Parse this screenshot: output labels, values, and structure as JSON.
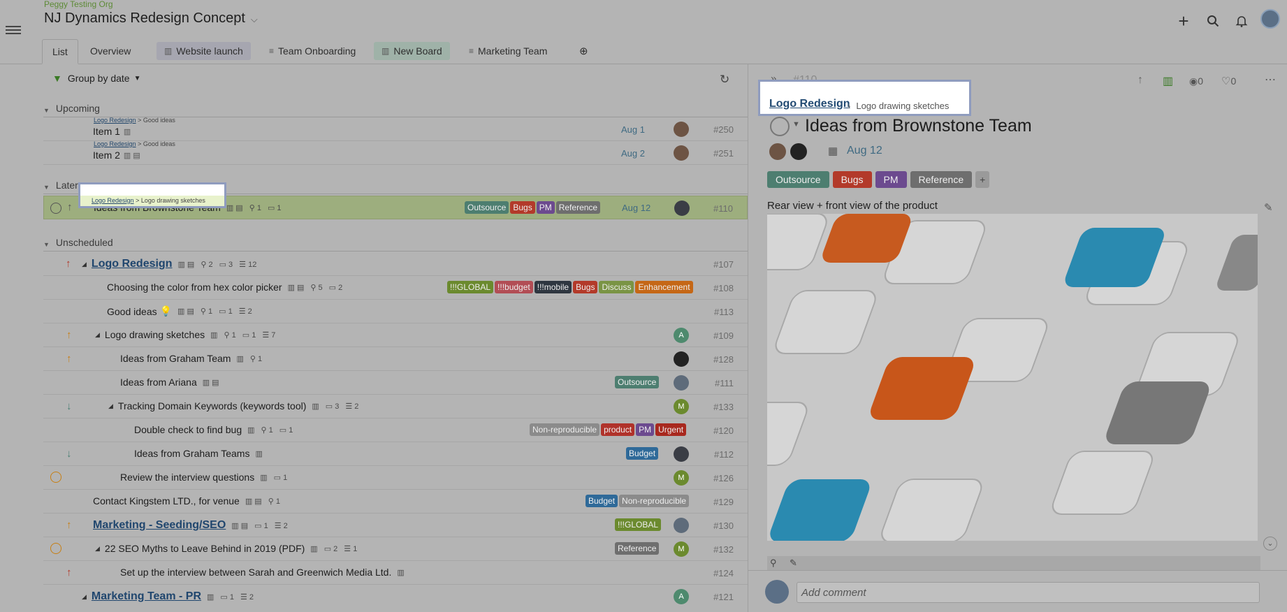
{
  "header": {
    "org": "Peggy Testing Org",
    "title": "NJ Dynamics Redesign Concept"
  },
  "tabs": [
    "List",
    "Overview",
    "Website launch",
    "Team Onboarding",
    "New Board",
    "Marketing Team"
  ],
  "toolbar": {
    "group_by": "Group by date"
  },
  "sections": {
    "upcoming": "Upcoming",
    "later": "Later",
    "unscheduled": "Unscheduled"
  },
  "crumb_parent": "Logo Redesign",
  "crumb_good": "Good ideas",
  "crumb_sketch": "Logo drawing sketches",
  "rows": [
    {
      "name": "Item 1",
      "date": "Aug 1",
      "num": "#250"
    },
    {
      "name": "Item 2",
      "date": "Aug 2",
      "num": "#251"
    },
    {
      "name": "Ideas from Brownstone Team",
      "date": "Aug 12",
      "num": "#110",
      "attach": "1",
      "comments": "1"
    },
    {
      "name": "Logo Redesign",
      "num": "#107",
      "attach": "2",
      "comments": "3",
      "subtasks": "12"
    },
    {
      "name": "Choosing the color from hex color picker",
      "num": "#108",
      "attach": "5",
      "comments": "2"
    },
    {
      "name": "Good ideas",
      "num": "#113",
      "attach": "1",
      "comments": "1",
      "subtasks": "2"
    },
    {
      "name": "Logo drawing sketches",
      "num": "#109",
      "attach": "1",
      "comments": "1",
      "subtasks": "7"
    },
    {
      "name": "Ideas from Graham Team",
      "num": "#128",
      "attach": "1"
    },
    {
      "name": "Ideas from Ariana",
      "num": "#111"
    },
    {
      "name": "Tracking Domain Keywords (keywords tool)",
      "num": "#133",
      "comments": "3",
      "subtasks": "2"
    },
    {
      "name": "Double check to find bug",
      "num": "#120",
      "attach": "1",
      "comments": "1"
    },
    {
      "name": "Ideas from Graham Teams",
      "num": "#112"
    },
    {
      "name": "Review the interview questions",
      "num": "#126",
      "comments": "1"
    },
    {
      "name": "Contact Kingstem LTD., for venue",
      "num": "#129",
      "attach": "1"
    },
    {
      "name": "Marketing - Seeding/SEO",
      "num": "#130",
      "comments": "1",
      "subtasks": "2"
    },
    {
      "name": "22 SEO Myths to Leave Behind in 2019 (PDF)",
      "num": "#132",
      "comments": "2",
      "subtasks": "1"
    },
    {
      "name": "Set up the interview between Sarah and Greenwich Media Ltd.",
      "num": "#124"
    },
    {
      "name": "Marketing Team - PR",
      "num": "#121",
      "comments": "1",
      "subtasks": "2"
    }
  ],
  "tags": {
    "outsource": "Outsource",
    "bugs": "Bugs",
    "pm": "PM",
    "reference": "Reference",
    "global": "!!!GLOBAL",
    "budget_x": "!!!budget",
    "mobile": "!!!mobile",
    "discuss": "Discuss",
    "enhancement": "Enhancement",
    "nonrepro": "Non-reproducible",
    "product": "product",
    "urgent": "Urgent",
    "budget": "Budget"
  },
  "detail": {
    "num": "#110",
    "watchers": "0",
    "likes": "0",
    "title": "Ideas from Brownstone Team",
    "date": "Aug 12",
    "description": "Rear view + front view of the product",
    "comment_placeholder": "Add comment"
  },
  "avatars": {
    "a": "A",
    "m": "M"
  },
  "colors": {
    "outsource": "#4d7e70",
    "bugs": "#b33a2a",
    "pm": "#6c4a8f",
    "reference": "#6e6e6e",
    "global": "#6b8a2e",
    "budget_x": "#b24d55",
    "mobile": "#2e3640",
    "discuss": "#7a9444",
    "enhancement": "#c56716",
    "nonrepro": "#8b8b8b",
    "product": "#b0322a",
    "urgent": "#a8281e",
    "budget": "#2f6a99"
  }
}
